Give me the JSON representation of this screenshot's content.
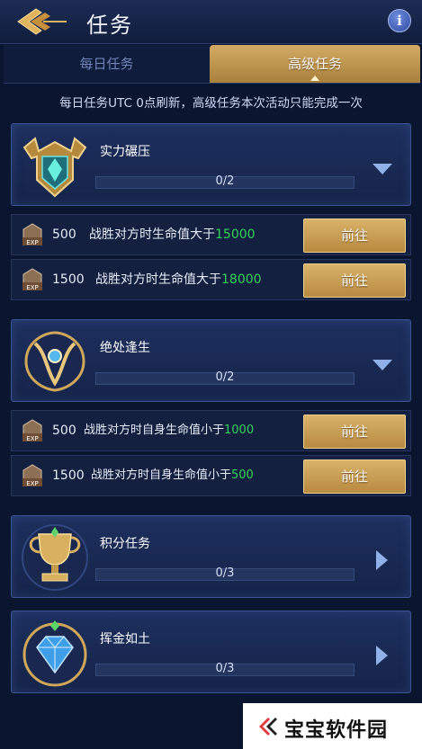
{
  "header": {
    "title": "任务",
    "info_icon": "info-icon",
    "back_icon": "back-arrow-icon"
  },
  "tabs": [
    {
      "label": "每日任务",
      "active": false
    },
    {
      "label": "高级任务",
      "active": true
    }
  ],
  "notice": "每日任务UTC 0点刷新，高级任务本次活动只能完成一次",
  "quests": [
    {
      "title": "实力碾压",
      "progress": "0/2",
      "expanded": true,
      "emblem": "shield-emblem-icon",
      "subtasks": [
        {
          "exp": "500",
          "text": "战胜对方时生命值大于",
          "value": "15000",
          "button": "前往"
        },
        {
          "exp": "1500",
          "text": "战胜对方时生命值大于",
          "value": "18000",
          "button": "前往"
        }
      ]
    },
    {
      "title": "绝处逢生",
      "progress": "0/2",
      "expanded": true,
      "emblem": "horned-crest-emblem-icon",
      "subtasks": [
        {
          "exp": "500",
          "text": "战胜对方时自身生命值小于",
          "value": "1000",
          "button": "前往"
        },
        {
          "exp": "1500",
          "text": "战胜对方时自身生命值小于",
          "value": "500",
          "button": "前往"
        }
      ]
    },
    {
      "title": "积分任务",
      "progress": "0/3",
      "expanded": false,
      "emblem": "trophy-emblem-icon"
    },
    {
      "title": "挥金如土",
      "progress": "0/3",
      "expanded": false,
      "emblem": "diamond-emblem-icon"
    }
  ],
  "watermark": {
    "text": "宝宝软件园"
  },
  "colors": {
    "accent_gold": "#c9a05a",
    "value_green": "#34d35a",
    "panel_blue": "#1d2f5e"
  }
}
